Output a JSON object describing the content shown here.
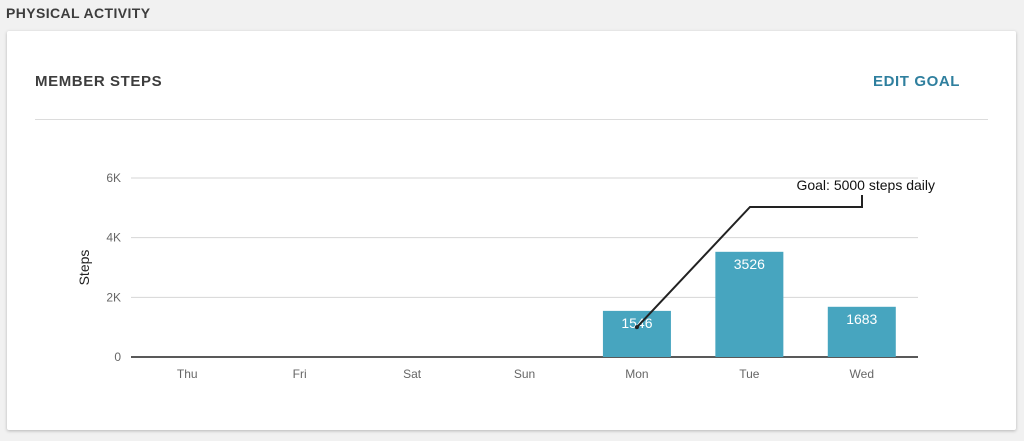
{
  "section": {
    "title": "PHYSICAL ACTIVITY"
  },
  "card": {
    "title": "MEMBER STEPS",
    "edit_goal_label": "EDIT GOAL"
  },
  "chart_data": {
    "type": "bar",
    "categories": [
      "Thu",
      "Fri",
      "Sat",
      "Sun",
      "Mon",
      "Tue",
      "Wed"
    ],
    "values": [
      0,
      0,
      0,
      0,
      1546,
      3526,
      1683
    ],
    "data_labels": [
      "",
      "",
      "",
      "",
      "1546",
      "3526",
      "1683"
    ],
    "ylabel": "Steps",
    "ylim": [
      0,
      6000
    ],
    "yticks": [
      0,
      2000,
      4000,
      6000
    ],
    "ytick_labels": [
      "0",
      "2K",
      "4K",
      "6K"
    ],
    "grid": true,
    "bar_color": "#47a5bf",
    "annotation": {
      "text": "Goal: 5000 steps daily",
      "category": "Mon",
      "value": 1000
    }
  }
}
